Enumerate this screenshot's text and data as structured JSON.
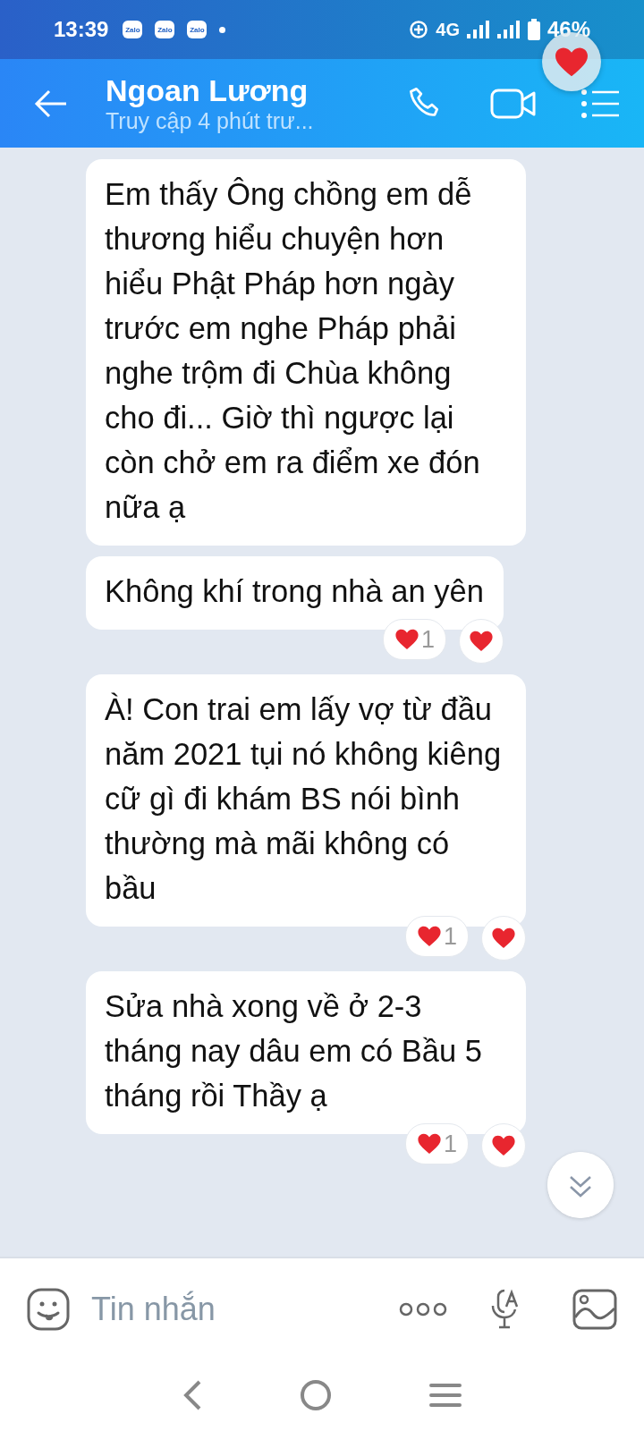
{
  "status_bar": {
    "time": "13:39",
    "notifications": [
      "Zalo",
      "Zalo",
      "Zalo"
    ],
    "network": "4G",
    "battery": "46%"
  },
  "header": {
    "name": "Ngoan Lương",
    "subtitle": "Truy cập 4 phút trư..."
  },
  "messages": [
    {
      "text": "Em thấy Ông chồng em dễ thương hiểu chuyện hơn hiểu Phật Pháp hơn ngày trước em nghe Pháp phải nghe trộm đi Chùa không cho đi... Giờ thì ngược lại còn chở em ra điểm xe đón nữa ạ"
    },
    {
      "text": "Không khí trong nhà an yên",
      "reaction_count": "1"
    },
    {
      "text": "À! Con trai em lấy vợ từ đầu năm 2021 tụi nó không kiêng cữ gì đi khám BS nói bình thường mà mãi không có bầu",
      "reaction_count": "1"
    },
    {
      "text": "Sửa nhà xong về ở 2-3 tháng nay dâu em có Bầu 5 tháng rồi Thầy ạ",
      "reaction_count": "1"
    }
  ],
  "composer": {
    "placeholder": "Tin nhắn"
  }
}
